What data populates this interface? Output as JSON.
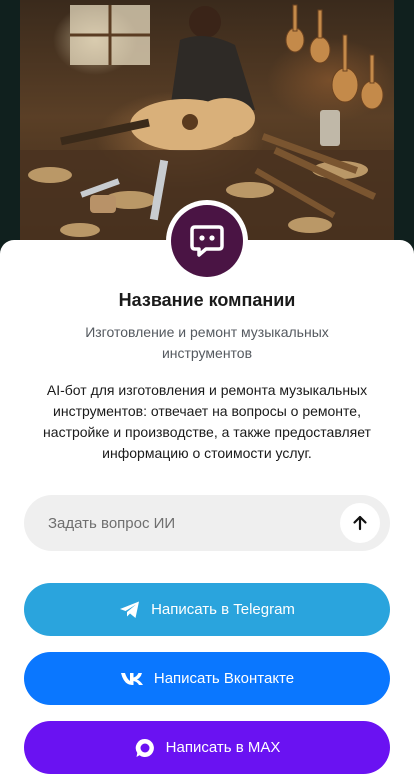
{
  "company": {
    "name": "Название компании",
    "subtitle": "Изготовление и ремонт музыкальных инструментов",
    "description": "AI-бот для изготовления и ремонта музыкальных инструментов: отвечает на вопросы о ремонте, настройке и производстве, а также предоставляет информацию о стоимости услуг."
  },
  "ask": {
    "placeholder": "Задать вопрос ИИ",
    "send_icon": "arrow-up-icon"
  },
  "buttons": {
    "telegram": {
      "label": "Написать в Telegram",
      "icon": "telegram-icon",
      "color": "#2aa4dd"
    },
    "vk": {
      "label": "Написать Вконтакте",
      "icon": "vk-icon",
      "color": "#0a77ff"
    },
    "max": {
      "label": "Написать в MAX",
      "icon": "max-icon",
      "color": "#6a12f2"
    }
  },
  "avatar": {
    "icon": "chat-bubble-icon",
    "color": "#4a1444"
  },
  "hero": {
    "image": "luthier-workshop-photo"
  }
}
